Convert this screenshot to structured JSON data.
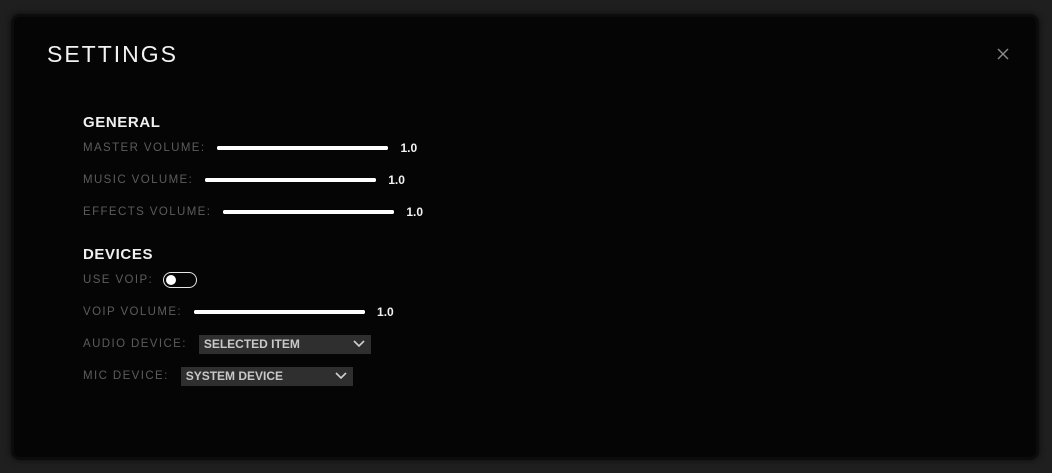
{
  "title": "SETTINGS",
  "icons": {
    "close": "close-icon",
    "chevron": "chevron-down-icon"
  },
  "general": {
    "label": "GENERAL",
    "master_volume": {
      "label": "MASTER VOLUME:",
      "value": "1.0",
      "level": 1.0
    },
    "music_volume": {
      "label": "MUSIC VOLUME:",
      "value": "1.0",
      "level": 1.0
    },
    "effects_volume": {
      "label": "EFFECTS VOLUME:",
      "value": "1.0",
      "level": 1.0
    }
  },
  "devices": {
    "label": "DEVICES",
    "use_voip": {
      "label": "USE VOIP:",
      "enabled": false
    },
    "voip_volume": {
      "label": "VOIP VOLUME:",
      "value": "1.0",
      "level": 1.0
    },
    "audio_device": {
      "label": "AUDIO DEVICE:",
      "selected": "SELECTED ITEM"
    },
    "mic_device": {
      "label": "MIC DEVICE:",
      "selected": "SYSTEM DEVICE"
    }
  },
  "colors": {
    "panel": "#050505",
    "text": "#f2f2f2",
    "label": "#5c5c5c",
    "dropdown": "#2f2f2f"
  }
}
